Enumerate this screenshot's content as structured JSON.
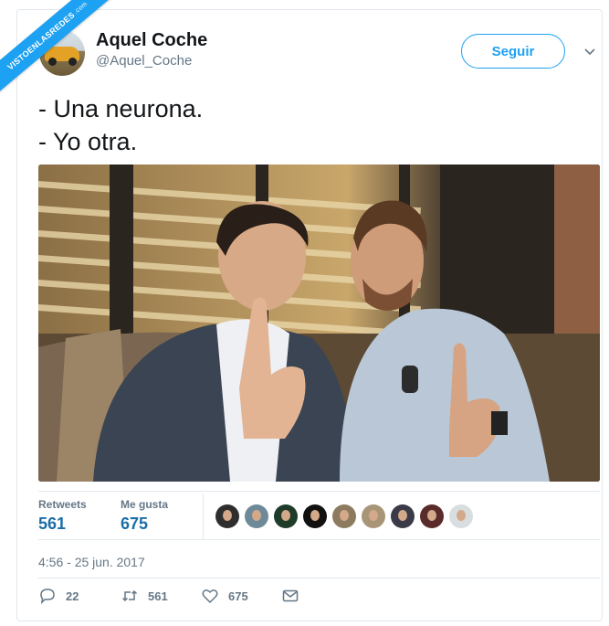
{
  "watermark": {
    "text": "VISTOENLASREDES",
    "suffix": ".com"
  },
  "author": {
    "name": "Aquel Coche",
    "handle": "@Aquel_Coche"
  },
  "follow_button": "Seguir",
  "tweet_lines": [
    "- Una neurona.",
    "- Yo otra."
  ],
  "stats": {
    "retweets_label": "Retweets",
    "retweets_value": "561",
    "likes_label": "Me gusta",
    "likes_value": "675"
  },
  "likers": [
    {
      "color": "#2e2e2e",
      "icon": "avatar"
    },
    {
      "color": "#6e8a99",
      "icon": "avatar"
    },
    {
      "color": "#1f3b2a",
      "icon": "avatar"
    },
    {
      "color": "#111111",
      "icon": "avatar"
    },
    {
      "color": "#8c7b5e",
      "icon": "avatar"
    },
    {
      "color": "#a89578",
      "icon": "avatar"
    },
    {
      "color": "#3b3a48",
      "icon": "avatar"
    },
    {
      "color": "#5a2b2b",
      "icon": "avatar"
    },
    {
      "color": "#d8dedf",
      "icon": "avatar"
    }
  ],
  "timestamp": "4:56 - 25 jun. 2017",
  "actions": {
    "reply_count": "22",
    "retweet_count": "561",
    "like_count": "675"
  },
  "colors": {
    "accent": "#1da1f2",
    "stat_value": "#1b6ea8",
    "muted": "#657786"
  }
}
